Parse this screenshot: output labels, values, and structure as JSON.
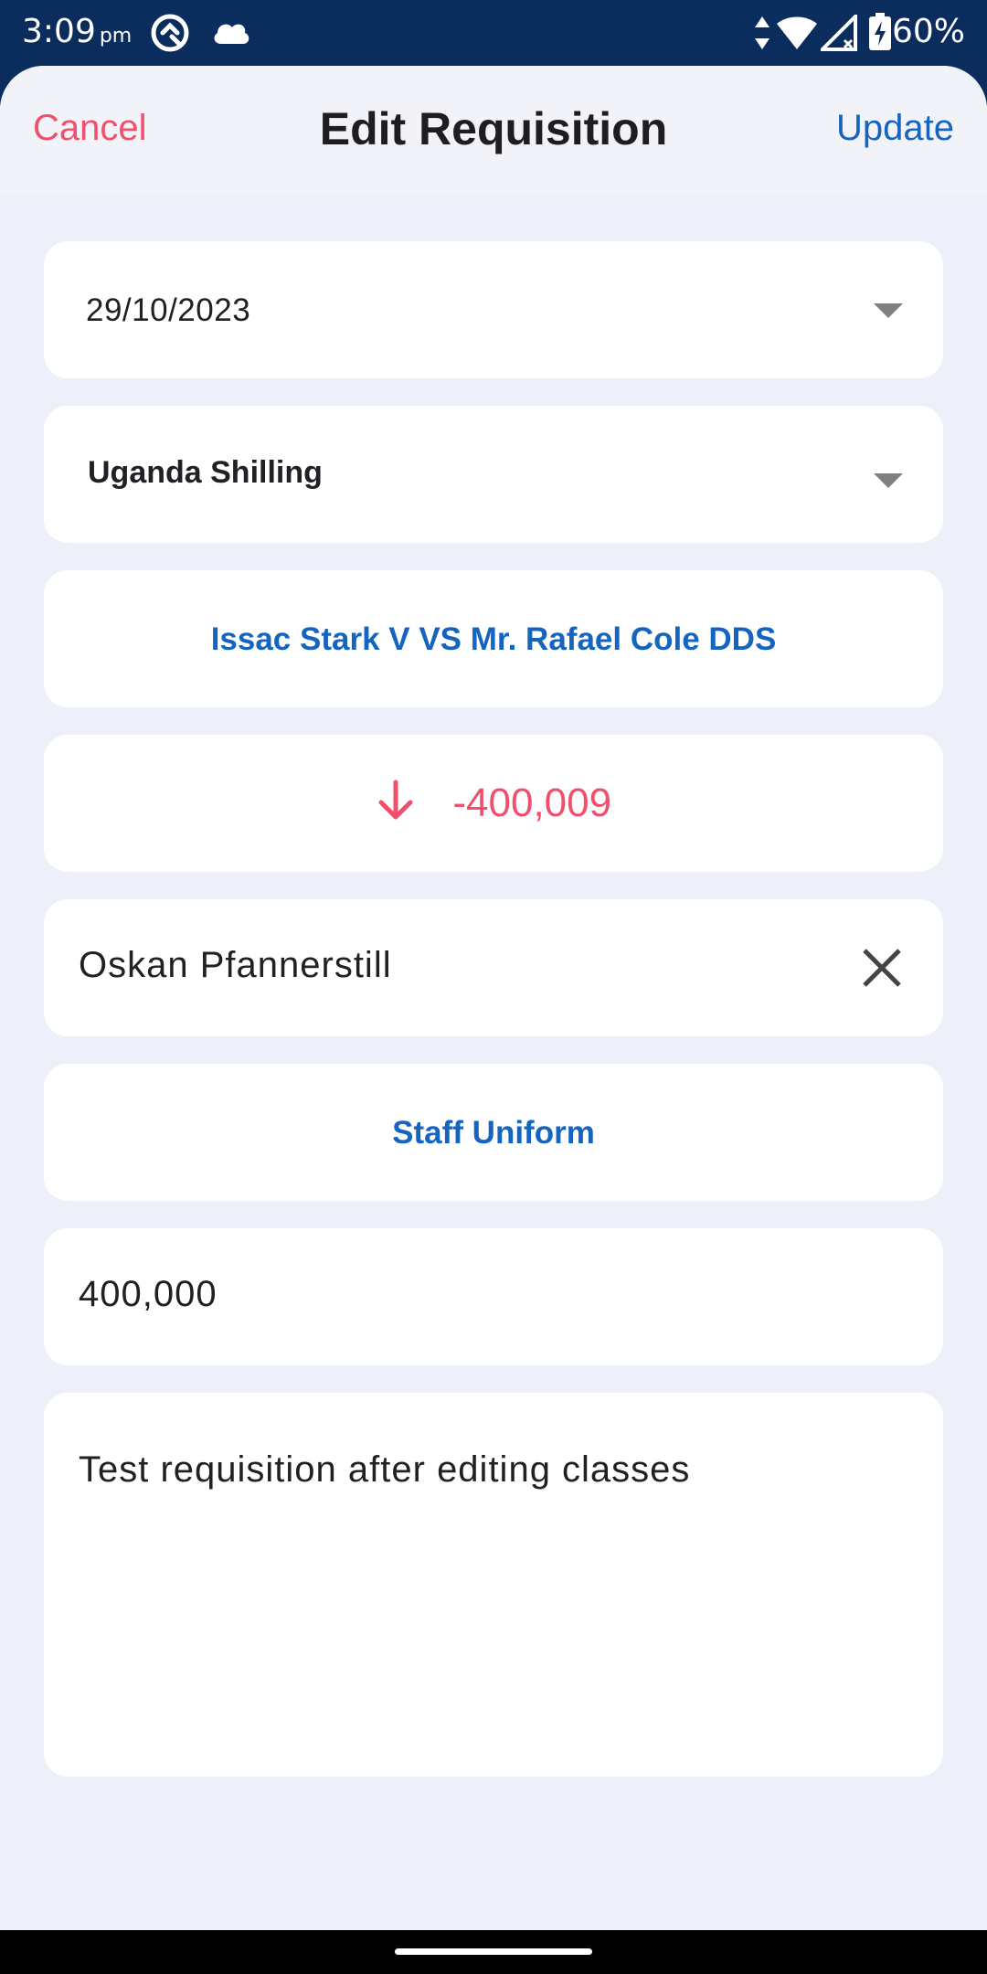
{
  "status_bar": {
    "time": "3:09",
    "ampm": "pm",
    "battery": "60%",
    "icons": [
      "app-logo-icon",
      "cloud-icon",
      "data-transfer-icon",
      "wifi-icon",
      "signal-icon",
      "battery-charging-icon"
    ]
  },
  "header": {
    "cancel_label": "Cancel",
    "title": "Edit Requisition",
    "update_label": "Update"
  },
  "form": {
    "date": "29/10/2023",
    "currency": "Uganda Shilling",
    "parties": "Issac Stark V VS Mr. Rafael Cole DDS",
    "balance": "-400,009",
    "payee": "Oskan Pfannerstill",
    "category": "Staff Uniform",
    "amount": "400,000",
    "description": "Test requisition after editing classes"
  },
  "colors": {
    "primary": "#1565c0",
    "danger": "#f0506e",
    "status_bar": "#0a2d5e",
    "background": "#eef0f9"
  }
}
